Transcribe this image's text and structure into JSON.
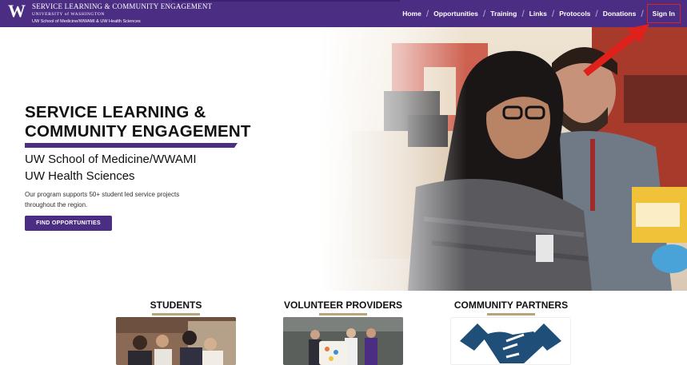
{
  "header": {
    "logo": "W",
    "brand_title": "SERVICE LEARNING & COMMUNITY ENGAGEMENT",
    "brand_university": "UNIVERSITY of WASHINGTON",
    "brand_subtitle": "UW School of Medicine/WWAMI & UW Health Sciences",
    "nav": [
      "Home",
      "Opportunities",
      "Training",
      "Links",
      "Protocols",
      "Donations",
      "Sign In"
    ]
  },
  "hero": {
    "title_line1": "SERVICE LEARNING &",
    "title_line2": "COMMUNITY ENGAGEMENT",
    "subtitle_line1": "UW School of Medicine/WWAMI",
    "subtitle_line2": "UW Health Sciences",
    "description": "Our program supports 50+ student led service projects throughout the region.",
    "cta_label": "FIND OPPORTUNITIES"
  },
  "sections": [
    {
      "title": "STUDENTS"
    },
    {
      "title": "VOLUNTEER PROVIDERS"
    },
    {
      "title": "COMMUNITY PARTNERS"
    }
  ],
  "colors": {
    "brand_purple": "#4b2e83",
    "gold": "#b7a57a",
    "annotation_red": "#e0201a"
  },
  "icons": [
    "uw-logo",
    "handshake-icon"
  ]
}
